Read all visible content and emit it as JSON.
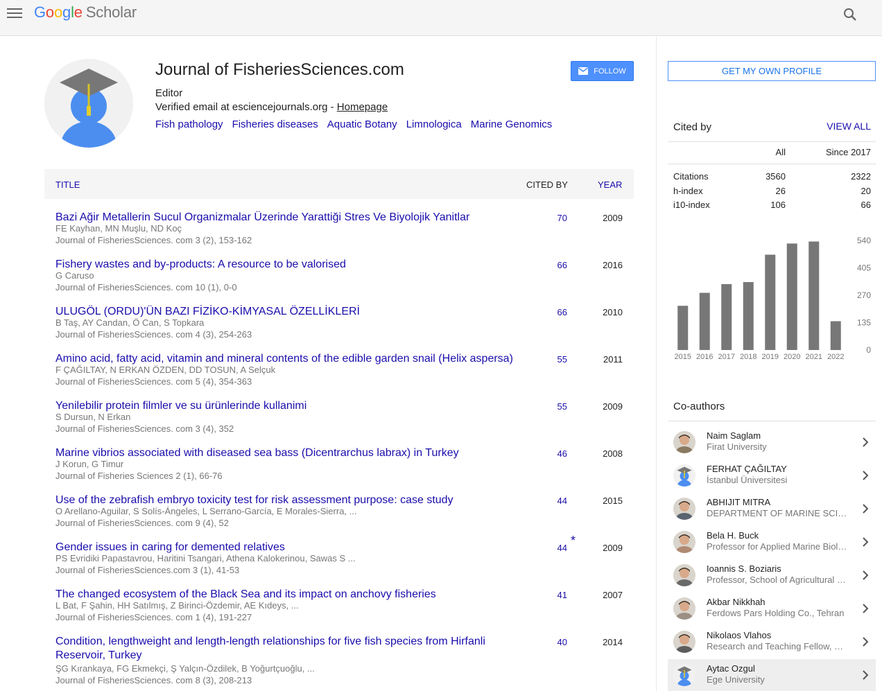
{
  "header": {
    "logo_parts": [
      "G",
      "o",
      "o",
      "g",
      "l",
      "e"
    ],
    "logo_product": "Scholar"
  },
  "profile": {
    "name": "Journal of FisheriesSciences.com",
    "affiliation": "Editor",
    "verified_text": "Verified email at esciencejournals.org - ",
    "homepage_label": "Homepage",
    "interests": [
      "Fish pathology",
      "Fisheries diseases",
      "Aquatic Botany",
      "Limnologica",
      "Marine Genomics"
    ],
    "follow_label": "FOLLOW"
  },
  "table": {
    "col_title": "TITLE",
    "col_cited": "CITED BY",
    "col_year": "YEAR",
    "rows": [
      {
        "title": "Bazi Ağir Metallerin Sucul Organizmalar Üzerinde Yarattiği Stres Ve Biyolojik Yanitlar",
        "authors": "FE Kayhan, MN Muşlu, ND Koç",
        "source": "Journal of FisheriesSciences. com 3 (2), 153-162",
        "cited": "70",
        "year": "2009",
        "star": ""
      },
      {
        "title": "Fishery wastes and by-products: A resource to be valorised",
        "authors": "G Caruso",
        "source": "Journal of FisheriesSciences. com 10 (1), 0-0",
        "cited": "66",
        "year": "2016",
        "star": ""
      },
      {
        "title": "ULUGÖL (ORDU)'ÜN BAZI FİZİKO-KİMYASAL ÖZELLİKLERİ",
        "authors": "B Taş, AY Candan, Ö Can, S Topkara",
        "source": "Journal of FisheriesSciences. com 4 (3), 254-263",
        "cited": "66",
        "year": "2010",
        "star": ""
      },
      {
        "title": "Amino acid, fatty acid, vitamin and mineral contents of the edible garden snail (Helix aspersa)",
        "authors": "F ÇAĞILTAY, N ERKAN ÖZDEN, DD TOSUN, A Selçuk",
        "source": "Journal of FisheriesSciences. com 5 (4), 354-363",
        "cited": "55",
        "year": "2011",
        "star": ""
      },
      {
        "title": "Yenilebilir protein filmler ve su ürünlerinde kullanimi",
        "authors": "S Dursun, N Erkan",
        "source": "Journal of FisheriesSciences. com 3 (4), 352",
        "cited": "55",
        "year": "2009",
        "star": ""
      },
      {
        "title": "Marine vibrios associated with diseased sea bass (Dicentrarchus labrax) in Turkey",
        "authors": "J Korun, G Timur",
        "source": "Journal of Fisheries Sciences 2 (1), 66-76",
        "cited": "46",
        "year": "2008",
        "star": ""
      },
      {
        "title": "Use of the zebrafish embryo toxicity test for risk assessment purpose: case study",
        "authors": "O Arellano-Aguilar, S Solís-Ángeles, L Serrano-García, E Morales-Sierra, ...",
        "source": "Journal of FisheriesSciences. com 9 (4), 52",
        "cited": "44",
        "year": "2015",
        "star": ""
      },
      {
        "title": "Gender issues in caring for demented relatives",
        "authors": "PS Evridiki Papastavrou, Haritini Tsangari, Athena Kalokerinou, Sawas S ...",
        "source": "Journal of FisheriesSciences.com 3 (1), 41-53",
        "cited": "44",
        "year": "2009",
        "star": "*"
      },
      {
        "title": "The changed ecosystem of the Black Sea and its impact on anchovy fisheries",
        "authors": "L Bat, F Şahin, HH Satılmış, Z Birinci-Özdemir, AE Kıdeys, ...",
        "source": "Journal of FisheriesSciences. com 1 (4), 191-227",
        "cited": "41",
        "year": "2007",
        "star": ""
      },
      {
        "title": "Condition, lengthweight and length-length relationships for five fish species from Hirfanli Reservoir, Turkey",
        "authors": "ŞG Kırankaya, FG Ekmekçi, Ş Yalçın-Özdilek, B Yoğurtçuoğlu, ...",
        "source": "Journal of FisheriesSciences. com 8 (3), 208-213",
        "cited": "40",
        "year": "2014",
        "star": ""
      }
    ]
  },
  "sidebar": {
    "get_profile_label": "GET MY OWN PROFILE",
    "cited_by_heading": "Cited by",
    "view_all_label": "VIEW ALL",
    "stats_header": {
      "all": "All",
      "since": "Since 2017"
    },
    "stats": [
      {
        "label": "Citations",
        "all": "3560",
        "since": "2322"
      },
      {
        "label": "h-index",
        "all": "26",
        "since": "20"
      },
      {
        "label": "i10-index",
        "all": "106",
        "since": "66"
      }
    ],
    "coauthors_heading": "Co-authors",
    "coauthors": [
      {
        "name": "Naim Saglam",
        "affiliation": "Firat University",
        "pic": "photo-icon"
      },
      {
        "name": "FERHAT ÇAĞILTAY",
        "affiliation": "İstanbul Üniversitesi",
        "pic": "scholar-avatar-icon"
      },
      {
        "name": "ABHIJIT MITRA",
        "affiliation": "DEPARTMENT OF MARINE SCIENCE, UNIVERSITY OF CALCUTTA",
        "pic": "photo-icon"
      },
      {
        "name": "Bela H. Buck",
        "affiliation": "Professor for Applied Marine Biology",
        "pic": "photo-icon"
      },
      {
        "name": "Ioannis S. Boziaris",
        "affiliation": "Professor, School of Agricultural Sciences",
        "pic": "photo-icon"
      },
      {
        "name": "Akbar Nikkhah",
        "affiliation": "Ferdows Pars Holding Co., Tehran",
        "pic": "photo-icon"
      },
      {
        "name": "Nikolaos Vlahos",
        "affiliation": "Research and Teaching Fellow, University",
        "pic": "photo-icon"
      },
      {
        "name": "Aytac Ozgul",
        "affiliation": "Ege University",
        "pic": "scholar-avatar-icon"
      }
    ]
  },
  "chart_data": {
    "type": "bar",
    "categories": [
      "2015",
      "2016",
      "2017",
      "2018",
      "2019",
      "2020",
      "2021",
      "2022"
    ],
    "values": [
      218,
      282,
      325,
      335,
      470,
      525,
      535,
      142
    ],
    "yticks": [
      "540",
      "405",
      "270",
      "135",
      "0"
    ],
    "ylim": [
      0,
      540
    ],
    "bar_color": "#777777"
  }
}
